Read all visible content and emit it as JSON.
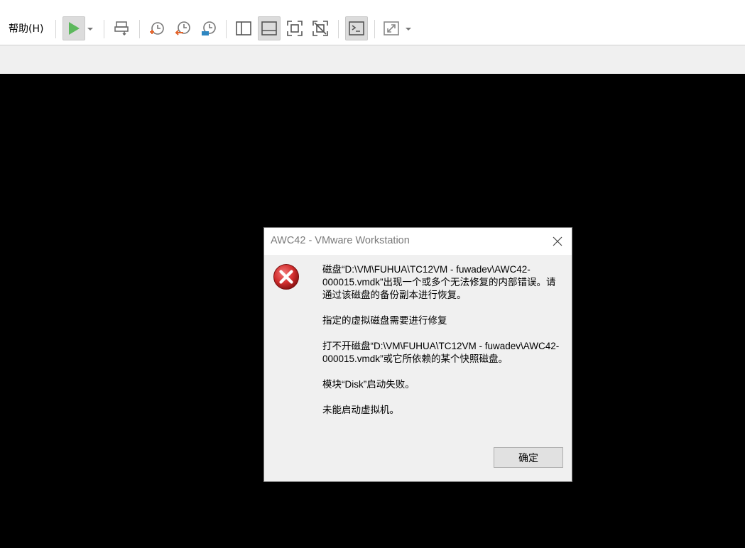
{
  "menu": {
    "help_label": "帮助(H)"
  },
  "toolbar": {
    "icons": [
      "power-on-icon",
      "send-ctrl-alt-del-icon",
      "snapshot-take-icon",
      "snapshot-revert-icon",
      "snapshot-manager-icon",
      "library-view-icon",
      "thumbnail-bar-icon",
      "full-screen-icon",
      "unity-icon",
      "console-view-icon",
      "stretch-guest-icon"
    ],
    "accent_play": "#5cb85c"
  },
  "dialog": {
    "title": "AWC42 - VMware Workstation",
    "messages": [
      "磁盘“D:\\VM\\FUHUA\\TC12VM - fuwadev\\AWC42-000015.vmdk”出现一个或多个无法修复的内部错误。请通过该磁盘的备份副本进行恢复。",
      "指定的虚拟磁盘需要进行修复",
      "打不开磁盘“D:\\VM\\FUHUA\\TC12VM - fuwadev\\AWC42-000015.vmdk”或它所依赖的某个快照磁盘。",
      "模块“Disk”启动失败。",
      "未能启动虚拟机。"
    ],
    "ok_label": "确定",
    "error_icon_color": "#d32f2f"
  }
}
